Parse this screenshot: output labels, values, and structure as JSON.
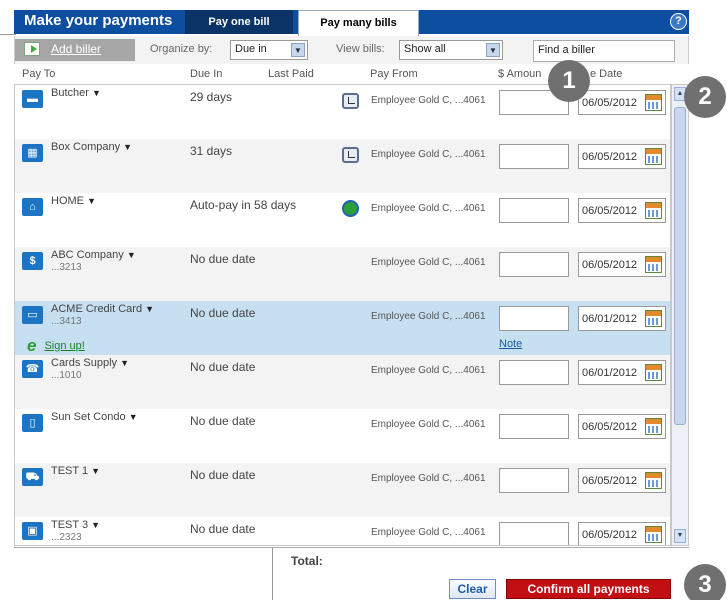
{
  "header": {
    "title": "Make your payments",
    "tabs": [
      {
        "label": "Pay one bill"
      },
      {
        "label": "Pay many bills"
      }
    ],
    "help_glyph": "?"
  },
  "toolbar": {
    "add_biller": "Add biller",
    "organize_label": "Organize by:",
    "organize_value": "Due in",
    "view_label": "View bills:",
    "view_value": "Show all",
    "find_value": "Find a biller"
  },
  "columns": {
    "pay_to": "Pay To",
    "due_in": "Due In",
    "last_paid": "Last Paid",
    "pay_from": "Pay From",
    "amount": "$ Amoun",
    "date": "e Date"
  },
  "rows": [
    {
      "name": "Butcher",
      "account": "",
      "due": "29 days",
      "pay_from": "Employee Gold C, ...4061",
      "date": "06/05/2012",
      "icon": "butcher-icon",
      "glyph": "▬"
    },
    {
      "name": "Box Company",
      "account": "",
      "due": "31 days",
      "pay_from": "Employee Gold C, ...4061",
      "date": "06/05/2012",
      "icon": "gift-box-icon",
      "glyph": "🎁"
    },
    {
      "name": "HOME",
      "account": "",
      "due": "Auto-pay in 58 days",
      "pay_from": "Employee Gold C, ...4061",
      "date": "06/05/2012",
      "icon": "house-icon",
      "glyph": "⌂"
    },
    {
      "name": "ABC Company",
      "account": "...3213",
      "due": "No due date",
      "pay_from": "Employee Gold C, ...4061",
      "date": "06/05/2012",
      "icon": "dollar-icon",
      "glyph": "$"
    },
    {
      "name": "ACME Credit Card",
      "account": "...3413",
      "due": "No due date",
      "pay_from": "Employee Gold C, ...4061",
      "date": "06/01/2012",
      "icon": "credit-card-icon",
      "glyph": "▭",
      "signup": "Sign up!",
      "note": "Note"
    },
    {
      "name": "Cards Supply",
      "account": "...1010",
      "due": "No due date",
      "pay_from": "Employee Gold C, ...4061",
      "date": "06/01/2012",
      "icon": "phone-icon",
      "glyph": "☎"
    },
    {
      "name": "Sun Set Condo",
      "account": "",
      "due": "No due date",
      "pay_from": "Employee Gold C, ...4061",
      "date": "06/05/2012",
      "icon": "mobile-icon",
      "glyph": "▯"
    },
    {
      "name": "TEST 1",
      "account": "",
      "due": "No due date",
      "pay_from": "Employee Gold C, ...4061",
      "date": "06/05/2012",
      "icon": "car-icon",
      "glyph": "⛟"
    },
    {
      "name": "TEST 3",
      "account": "...2323",
      "due": "No due date",
      "pay_from": "Employee Gold C, ...4061",
      "date": "06/05/2012",
      "icon": "bag-icon",
      "glyph": "▣"
    }
  ],
  "footer": {
    "total_label": "Total:",
    "clear_label": "Clear",
    "confirm_label": "Confirm all payments"
  },
  "markers": [
    "1",
    "2",
    "3"
  ]
}
